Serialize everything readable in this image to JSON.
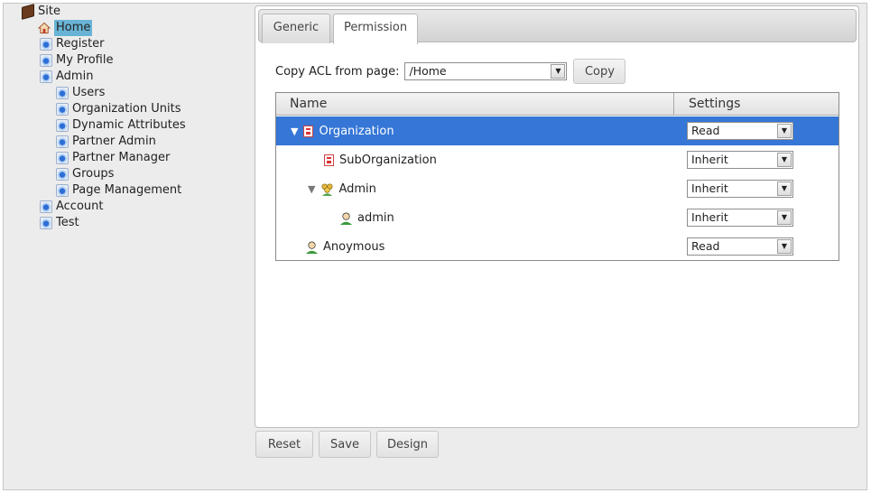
{
  "tree": {
    "root": "Site",
    "items": [
      {
        "label": "Home"
      },
      {
        "label": "Register"
      },
      {
        "label": "My Profile"
      },
      {
        "label": "Admin"
      },
      {
        "label": "Users"
      },
      {
        "label": "Organization Units"
      },
      {
        "label": "Dynamic Attributes"
      },
      {
        "label": "Partner Admin"
      },
      {
        "label": "Partner Manager"
      },
      {
        "label": "Groups"
      },
      {
        "label": "Page Management"
      },
      {
        "label": "Account"
      },
      {
        "label": "Test"
      }
    ]
  },
  "tabs": [
    {
      "label": "Generic"
    },
    {
      "label": "Permission"
    }
  ],
  "copy_acl": {
    "label": "Copy ACL from page:",
    "value": "/Home",
    "button": "Copy"
  },
  "grid": {
    "columns": [
      "Name",
      "Settings"
    ],
    "rows": [
      {
        "name": "Organization",
        "setting": "Read"
      },
      {
        "name": "SubOrganization",
        "setting": "Inherit"
      },
      {
        "name": "Admin",
        "setting": "Inherit"
      },
      {
        "name": "admin",
        "setting": "Inherit"
      },
      {
        "name": "Anoymous",
        "setting": "Read"
      }
    ]
  },
  "actions": {
    "reset": "Reset",
    "save": "Save",
    "design": "Design"
  },
  "icons": {
    "selection_color": "#3576d6",
    "tree_selected_color": "#69b4d6"
  }
}
